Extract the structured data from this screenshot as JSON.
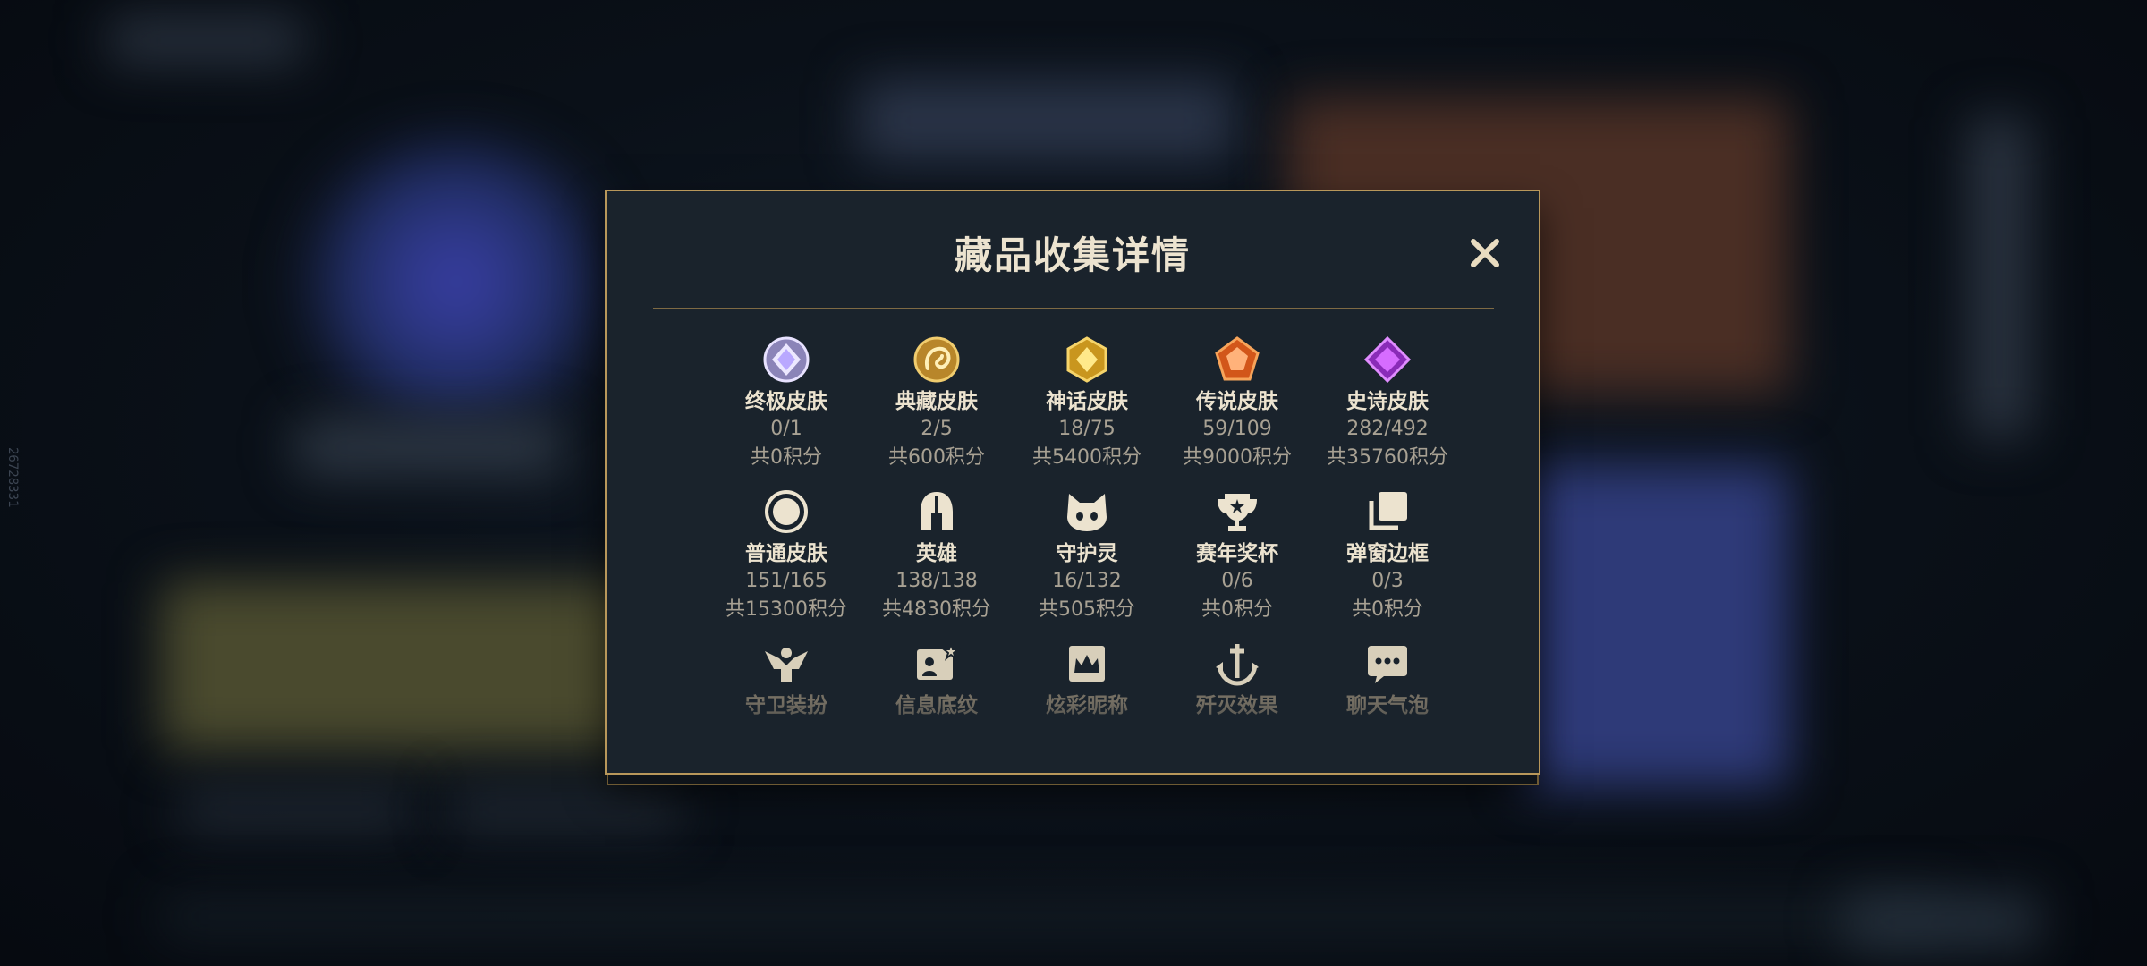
{
  "background": {
    "side_code": "26728331"
  },
  "modal": {
    "title": "藏品收集详情",
    "close_label": "×",
    "accent_color": "#b8975a"
  },
  "items": [
    {
      "icon": "ultimate-skin-gem-icon",
      "name": "终极皮肤",
      "count": "0/1",
      "points": "共0积分"
    },
    {
      "icon": "prestige-skin-dragon-icon",
      "name": "典藏皮肤",
      "count": "2/5",
      "points": "共600积分"
    },
    {
      "icon": "mythic-skin-gem-icon",
      "name": "神话皮肤",
      "count": "18/75",
      "points": "共5400积分"
    },
    {
      "icon": "legendary-skin-gem-icon",
      "name": "传说皮肤",
      "count": "59/109",
      "points": "共9000积分"
    },
    {
      "icon": "epic-skin-gem-icon",
      "name": "史诗皮肤",
      "count": "282/492",
      "points": "共35760积分"
    },
    {
      "icon": "common-skin-ring-icon",
      "name": "普通皮肤",
      "count": "151/165",
      "points": "共15300积分"
    },
    {
      "icon": "champion-helmet-icon",
      "name": "英雄",
      "count": "138/138",
      "points": "共4830积分"
    },
    {
      "icon": "guardian-pet-icon",
      "name": "守护灵",
      "count": "16/132",
      "points": "共505积分"
    },
    {
      "icon": "season-trophy-icon",
      "name": "赛年奖杯",
      "count": "0/6",
      "points": "共0积分"
    },
    {
      "icon": "popup-frame-icon",
      "name": "弹窗边框",
      "count": "0/3",
      "points": "共0积分"
    },
    {
      "icon": "guardian-outfit-icon",
      "name": "守卫装扮",
      "count": "",
      "points": ""
    },
    {
      "icon": "profile-banner-icon",
      "name": "信息底纹",
      "count": "",
      "points": ""
    },
    {
      "icon": "colorful-nickname-icon",
      "name": "炫彩昵称",
      "count": "",
      "points": ""
    },
    {
      "icon": "annihilation-effect-icon",
      "name": "歼灭效果",
      "count": "",
      "points": ""
    },
    {
      "icon": "chat-bubble-icon",
      "name": "聊天气泡",
      "count": "",
      "points": ""
    }
  ]
}
